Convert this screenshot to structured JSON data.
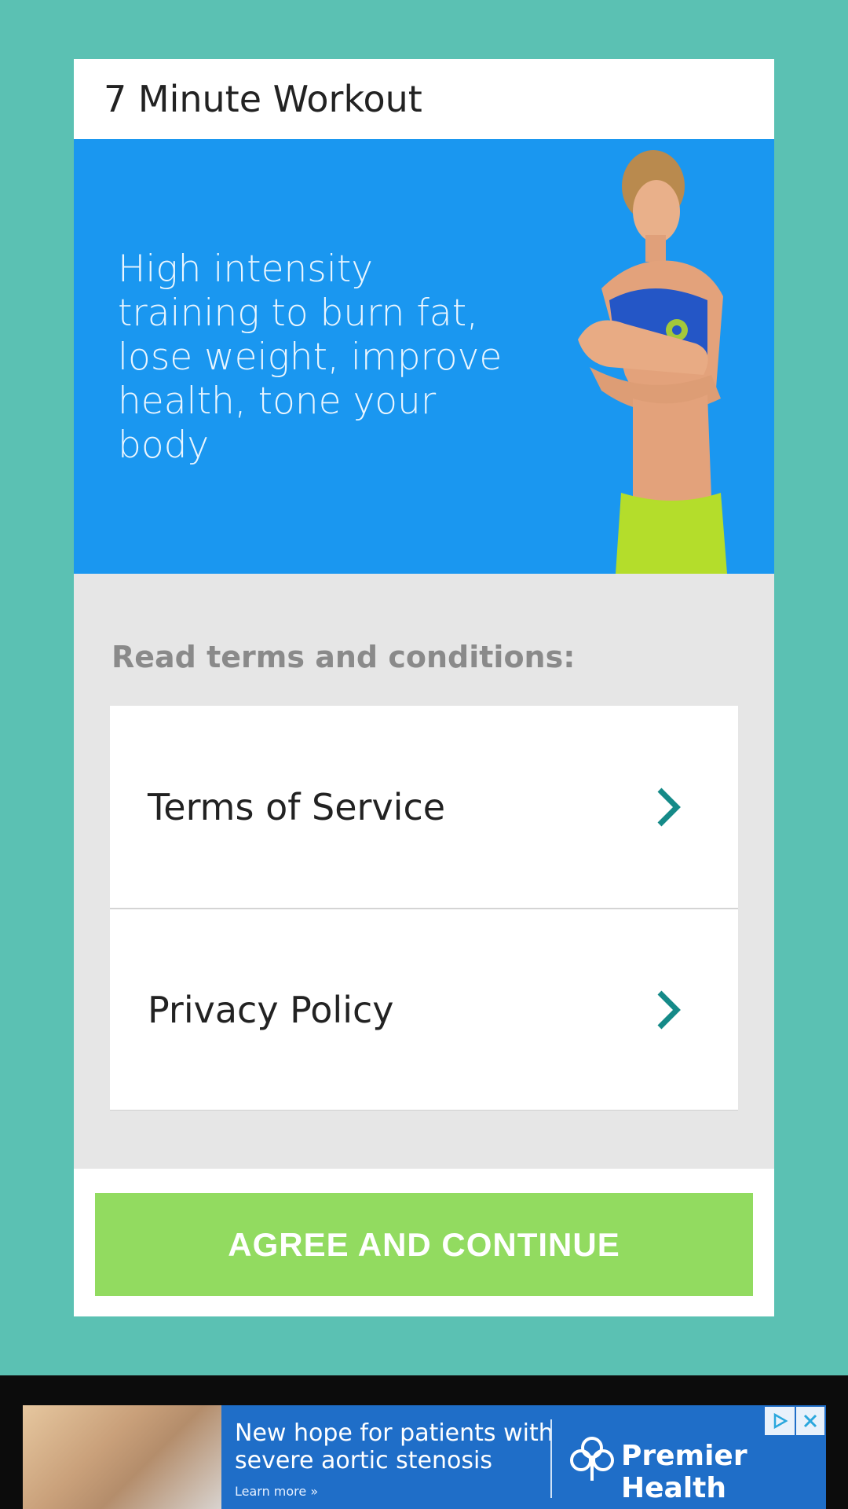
{
  "dialog": {
    "title": "7 Minute Workout",
    "hero_text": "High intensity training to burn fat, lose weight, improve health, tone your body",
    "terms_heading": "Read terms and conditions:",
    "items": [
      {
        "label": "Terms of Service",
        "icon": "chevron-right-icon"
      },
      {
        "label": "Privacy Policy",
        "icon": "chevron-right-icon"
      }
    ],
    "agree_label": "AGREE AND CONTINUE"
  },
  "ad": {
    "headline": "New hope for patients with severe aortic stenosis",
    "learn_more": "Learn more »",
    "brand": "Premier Health",
    "icons": [
      "adchoices-icon",
      "close-icon",
      "premier-health-logo"
    ]
  },
  "colors": {
    "background": "#5bc1b3",
    "hero": "#1a97f0",
    "button": "#92db60",
    "chevron": "#158a88"
  }
}
